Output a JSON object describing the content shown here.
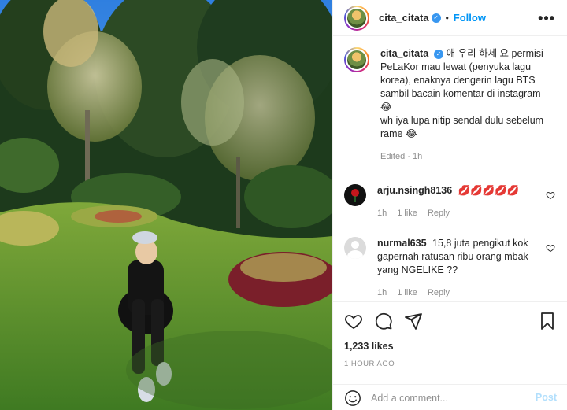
{
  "post": {
    "username": "cita_citata",
    "follow_label": "Follow",
    "dot": "•",
    "more_label": "•••"
  },
  "caption": {
    "username": "cita_citata",
    "text_line1": "애 우리 하세 요 permisi PeLaKor mau lewat (penyuka lagu korea), enaknya dengerin lagu BTS sambil bacain komentar di instagram",
    "emoji1": "😂",
    "text_line2": "wh iya lupa nitip sendal dulu sebelum rame",
    "emoji2": "😂",
    "edited": "Edited · 1h"
  },
  "comments": [
    {
      "username": "arju.nsingh8136",
      "text": "💋💋💋💋💋",
      "time": "1h",
      "likes": "1 like",
      "reply": "Reply"
    },
    {
      "username": "nurmal635",
      "text": "15,8 juta pengikut kok gapernah ratusan ribu orang mbak yang NGELIKE ??",
      "time": "1h",
      "likes": "1 like",
      "reply": "Reply"
    }
  ],
  "engagement": {
    "likes": "1,233 likes",
    "timestamp": "1 HOUR AGO"
  },
  "composer": {
    "placeholder": "Add a comment...",
    "post_label": "Post"
  },
  "colors": {
    "accent": "#0095f6",
    "verified": "#3897f0",
    "muted": "#8e8e8e"
  },
  "icons": [
    "verified-badge-icon",
    "heart-icon",
    "comment-icon",
    "share-icon",
    "bookmark-icon",
    "emoji-icon",
    "more-icon"
  ]
}
